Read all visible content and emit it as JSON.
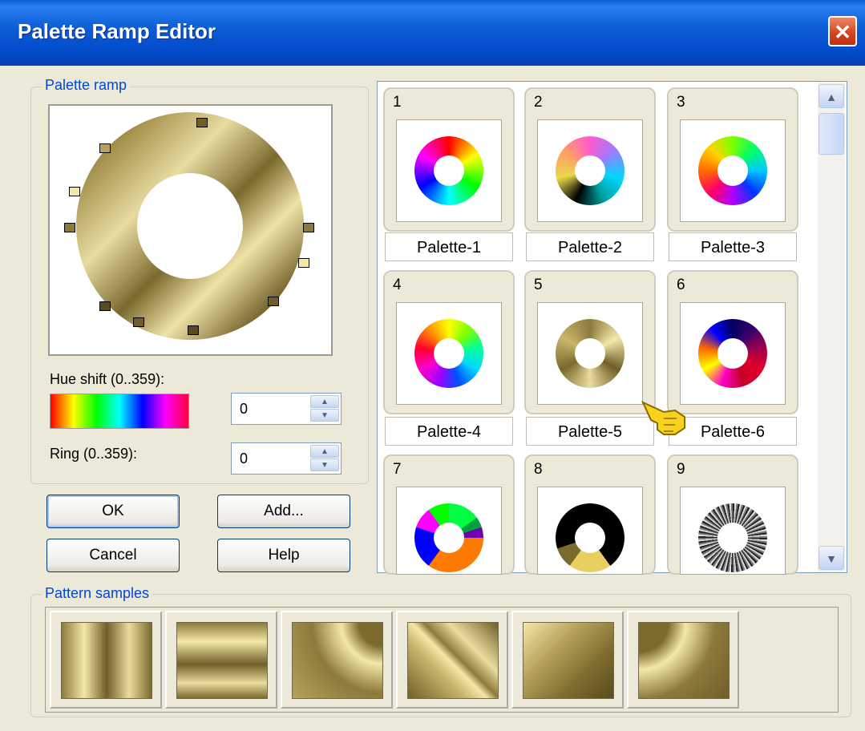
{
  "window": {
    "title": "Palette Ramp Editor",
    "close_icon": "close-icon"
  },
  "palette_ramp": {
    "group_label": "Palette ramp",
    "hue_shift_label": "Hue shift (0..359):",
    "hue_shift_value": "0",
    "ring_label": "Ring (0..359):",
    "ring_value": "0"
  },
  "buttons": {
    "ok": "OK",
    "add": "Add...",
    "cancel": "Cancel",
    "help": "Help"
  },
  "gallery": {
    "tiles": [
      {
        "number": "1",
        "name": "Palette-1"
      },
      {
        "number": "2",
        "name": "Palette-2"
      },
      {
        "number": "3",
        "name": "Palette-3"
      },
      {
        "number": "4",
        "name": "Palette-4"
      },
      {
        "number": "5",
        "name": "Palette-5"
      },
      {
        "number": "6",
        "name": "Palette-6"
      },
      {
        "number": "7",
        "name": ""
      },
      {
        "number": "8",
        "name": ""
      },
      {
        "number": "9",
        "name": ""
      }
    ]
  },
  "pattern_samples": {
    "group_label": "Pattern samples",
    "count": 6
  },
  "colors": {
    "title_bar": "#0a5fd8",
    "gold_dark": "#7a6a30",
    "gold_light": "#f3e8a8",
    "group_label": "#0046d5"
  }
}
